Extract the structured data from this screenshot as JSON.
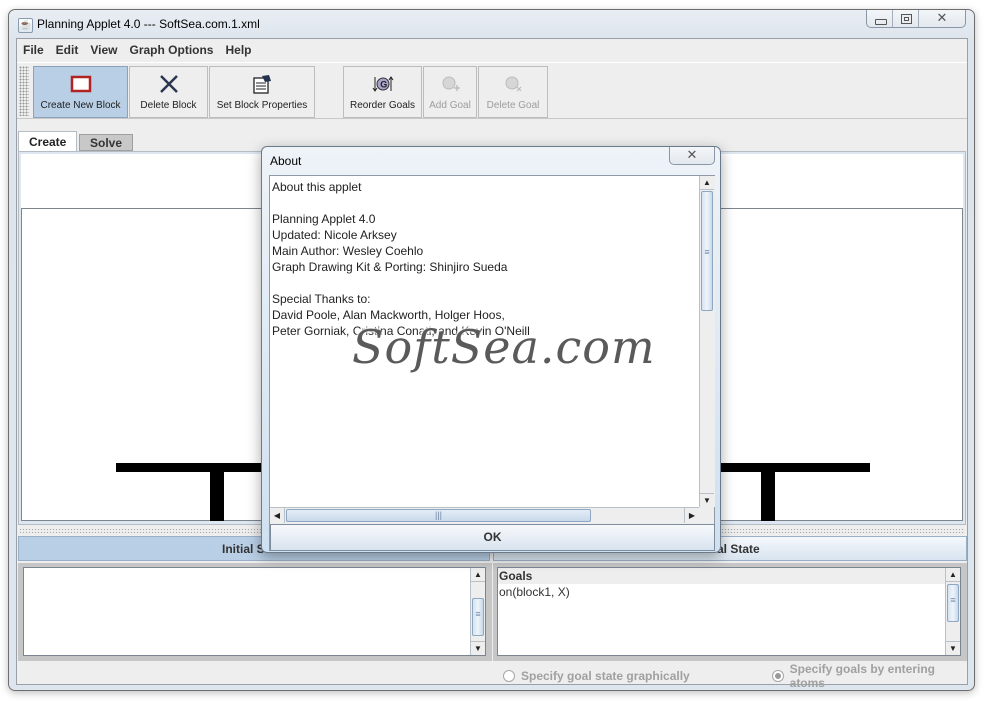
{
  "window": {
    "title": "Planning Applet 4.0 --- SoftSea.com.1.xml",
    "controls": [
      "minimize",
      "maximize",
      "close"
    ]
  },
  "menu": [
    "File",
    "Edit",
    "View",
    "Graph Options",
    "Help"
  ],
  "toolbar": {
    "buttons": [
      {
        "label": "Create New Block",
        "icon": "block-rectangle-icon",
        "state": "active"
      },
      {
        "label": "Delete Block",
        "icon": "x-delete-icon",
        "state": "enabled"
      },
      {
        "label": "Set Block Properties",
        "icon": "properties-icon",
        "state": "enabled"
      },
      {
        "label": "Reorder Goals",
        "icon": "reorder-goals-icon",
        "state": "enabled"
      },
      {
        "label": "Add Goal",
        "icon": "add-goal-icon",
        "state": "disabled"
      },
      {
        "label": "Delete Goal",
        "icon": "delete-goal-icon",
        "state": "disabled"
      }
    ]
  },
  "tabs": [
    {
      "label": "Create",
      "selected": true
    },
    {
      "label": "Solve",
      "selected": false
    }
  ],
  "panels": {
    "initial_state_header": "Initial State",
    "goal_state_header": "Goal State",
    "goals_list_header": "Goals",
    "goals": [
      "on(block1, X)"
    ]
  },
  "radios": [
    {
      "label": "Specify goal state graphically",
      "checked": false
    },
    {
      "label": "Specify goals by entering atoms",
      "checked": true
    }
  ],
  "dialog": {
    "title": "About",
    "close_glyph": "✕",
    "text": "About this applet\n\nPlanning Applet 4.0\nUpdated: Nicole Arksey\nMain Author: Wesley Coehlo\nGraph Drawing Kit & Porting: Shinjiro Sueda\n\nSpecial Thanks to:\nDavid Poole, Alan Mackworth, Holger Hoos,\nPeter Gorniak, Cristina Conati, and Kevin O'Neill",
    "ok_label": "OK"
  },
  "watermark": "SoftSea.com",
  "colors": {
    "active_button": "#b8cfe5",
    "block_red": "#b22222",
    "table_black": "#000000"
  }
}
